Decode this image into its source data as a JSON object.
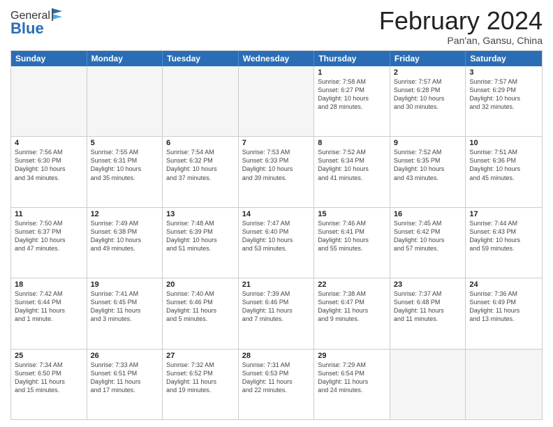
{
  "header": {
    "logo": {
      "line1": "General",
      "line2": "Blue"
    },
    "title": "February 2024",
    "subtitle": "Pan'an, Gansu, China"
  },
  "weekdays": [
    "Sunday",
    "Monday",
    "Tuesday",
    "Wednesday",
    "Thursday",
    "Friday",
    "Saturday"
  ],
  "rows": [
    [
      {
        "day": "",
        "info": ""
      },
      {
        "day": "",
        "info": ""
      },
      {
        "day": "",
        "info": ""
      },
      {
        "day": "",
        "info": ""
      },
      {
        "day": "1",
        "info": "Sunrise: 7:58 AM\nSunset: 6:27 PM\nDaylight: 10 hours\nand 28 minutes."
      },
      {
        "day": "2",
        "info": "Sunrise: 7:57 AM\nSunset: 6:28 PM\nDaylight: 10 hours\nand 30 minutes."
      },
      {
        "day": "3",
        "info": "Sunrise: 7:57 AM\nSunset: 6:29 PM\nDaylight: 10 hours\nand 32 minutes."
      }
    ],
    [
      {
        "day": "4",
        "info": "Sunrise: 7:56 AM\nSunset: 6:30 PM\nDaylight: 10 hours\nand 34 minutes."
      },
      {
        "day": "5",
        "info": "Sunrise: 7:55 AM\nSunset: 6:31 PM\nDaylight: 10 hours\nand 35 minutes."
      },
      {
        "day": "6",
        "info": "Sunrise: 7:54 AM\nSunset: 6:32 PM\nDaylight: 10 hours\nand 37 minutes."
      },
      {
        "day": "7",
        "info": "Sunrise: 7:53 AM\nSunset: 6:33 PM\nDaylight: 10 hours\nand 39 minutes."
      },
      {
        "day": "8",
        "info": "Sunrise: 7:52 AM\nSunset: 6:34 PM\nDaylight: 10 hours\nand 41 minutes."
      },
      {
        "day": "9",
        "info": "Sunrise: 7:52 AM\nSunset: 6:35 PM\nDaylight: 10 hours\nand 43 minutes."
      },
      {
        "day": "10",
        "info": "Sunrise: 7:51 AM\nSunset: 6:36 PM\nDaylight: 10 hours\nand 45 minutes."
      }
    ],
    [
      {
        "day": "11",
        "info": "Sunrise: 7:50 AM\nSunset: 6:37 PM\nDaylight: 10 hours\nand 47 minutes."
      },
      {
        "day": "12",
        "info": "Sunrise: 7:49 AM\nSunset: 6:38 PM\nDaylight: 10 hours\nand 49 minutes."
      },
      {
        "day": "13",
        "info": "Sunrise: 7:48 AM\nSunset: 6:39 PM\nDaylight: 10 hours\nand 51 minutes."
      },
      {
        "day": "14",
        "info": "Sunrise: 7:47 AM\nSunset: 6:40 PM\nDaylight: 10 hours\nand 53 minutes."
      },
      {
        "day": "15",
        "info": "Sunrise: 7:46 AM\nSunset: 6:41 PM\nDaylight: 10 hours\nand 55 minutes."
      },
      {
        "day": "16",
        "info": "Sunrise: 7:45 AM\nSunset: 6:42 PM\nDaylight: 10 hours\nand 57 minutes."
      },
      {
        "day": "17",
        "info": "Sunrise: 7:44 AM\nSunset: 6:43 PM\nDaylight: 10 hours\nand 59 minutes."
      }
    ],
    [
      {
        "day": "18",
        "info": "Sunrise: 7:42 AM\nSunset: 6:44 PM\nDaylight: 11 hours\nand 1 minute."
      },
      {
        "day": "19",
        "info": "Sunrise: 7:41 AM\nSunset: 6:45 PM\nDaylight: 11 hours\nand 3 minutes."
      },
      {
        "day": "20",
        "info": "Sunrise: 7:40 AM\nSunset: 6:46 PM\nDaylight: 11 hours\nand 5 minutes."
      },
      {
        "day": "21",
        "info": "Sunrise: 7:39 AM\nSunset: 6:46 PM\nDaylight: 11 hours\nand 7 minutes."
      },
      {
        "day": "22",
        "info": "Sunrise: 7:38 AM\nSunset: 6:47 PM\nDaylight: 11 hours\nand 9 minutes."
      },
      {
        "day": "23",
        "info": "Sunrise: 7:37 AM\nSunset: 6:48 PM\nDaylight: 11 hours\nand 11 minutes."
      },
      {
        "day": "24",
        "info": "Sunrise: 7:36 AM\nSunset: 6:49 PM\nDaylight: 11 hours\nand 13 minutes."
      }
    ],
    [
      {
        "day": "25",
        "info": "Sunrise: 7:34 AM\nSunset: 6:50 PM\nDaylight: 11 hours\nand 15 minutes."
      },
      {
        "day": "26",
        "info": "Sunrise: 7:33 AM\nSunset: 6:51 PM\nDaylight: 11 hours\nand 17 minutes."
      },
      {
        "day": "27",
        "info": "Sunrise: 7:32 AM\nSunset: 6:52 PM\nDaylight: 11 hours\nand 19 minutes."
      },
      {
        "day": "28",
        "info": "Sunrise: 7:31 AM\nSunset: 6:53 PM\nDaylight: 11 hours\nand 22 minutes."
      },
      {
        "day": "29",
        "info": "Sunrise: 7:29 AM\nSunset: 6:54 PM\nDaylight: 11 hours\nand 24 minutes."
      },
      {
        "day": "",
        "info": ""
      },
      {
        "day": "",
        "info": ""
      }
    ]
  ]
}
